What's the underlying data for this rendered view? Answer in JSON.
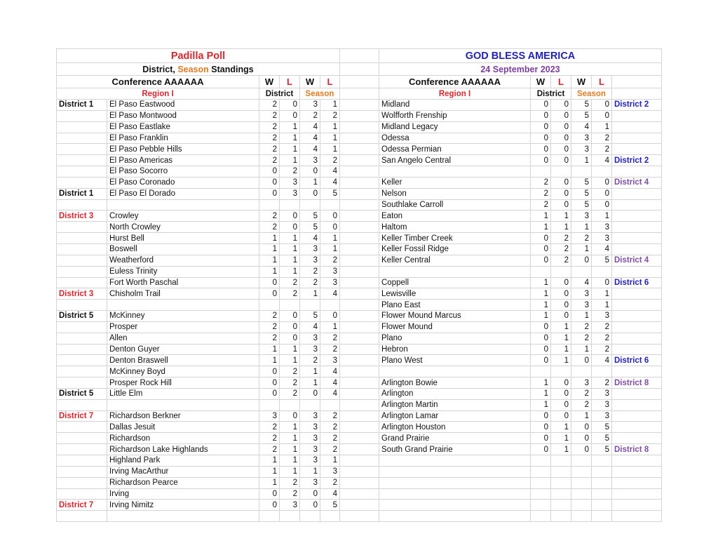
{
  "left": {
    "title": "Padilla Poll",
    "subtitle_parts": [
      "District, ",
      "Season",
      " Standings"
    ],
    "conference": "Conference AAAAAA",
    "region": "Region I",
    "col_w": "W",
    "col_l": "L",
    "group_district": "District",
    "group_season": "Season",
    "rows": [
      {
        "label": "District 1",
        "label_color": "black",
        "team": "El Paso Eastwood",
        "dw": "2",
        "dl": "0",
        "sw": "3",
        "sl": "1"
      },
      {
        "label": "",
        "label_color": "",
        "team": "El Paso Montwood",
        "dw": "2",
        "dl": "0",
        "sw": "2",
        "sl": "2"
      },
      {
        "label": "",
        "label_color": "",
        "team": "El Paso Eastlake",
        "dw": "2",
        "dl": "1",
        "sw": "4",
        "sl": "1"
      },
      {
        "label": "",
        "label_color": "",
        "team": "El Paso Franklin",
        "dw": "2",
        "dl": "1",
        "sw": "4",
        "sl": "1"
      },
      {
        "label": "",
        "label_color": "",
        "team": "El Paso Pebble Hills",
        "dw": "2",
        "dl": "1",
        "sw": "4",
        "sl": "1"
      },
      {
        "label": "",
        "label_color": "",
        "team": "El Paso Americas",
        "dw": "2",
        "dl": "1",
        "sw": "3",
        "sl": "2"
      },
      {
        "label": "",
        "label_color": "",
        "team": "El Paso Socorro",
        "dw": "0",
        "dl": "2",
        "sw": "0",
        "sl": "4"
      },
      {
        "label": "",
        "label_color": "",
        "team": "El Paso Coronado",
        "dw": "0",
        "dl": "3",
        "sw": "1",
        "sl": "4"
      },
      {
        "label": "District 1",
        "label_color": "black",
        "team": "El Paso El Dorado",
        "dw": "0",
        "dl": "3",
        "sw": "0",
        "sl": "5"
      },
      {
        "label": "",
        "label_color": "",
        "team": "",
        "dw": "",
        "dl": "",
        "sw": "",
        "sl": ""
      },
      {
        "label": "District 3",
        "label_color": "red",
        "team": "Crowley",
        "dw": "2",
        "dl": "0",
        "sw": "5",
        "sl": "0"
      },
      {
        "label": "",
        "label_color": "",
        "team": "North Crowley",
        "dw": "2",
        "dl": "0",
        "sw": "5",
        "sl": "0"
      },
      {
        "label": "",
        "label_color": "",
        "team": "Hurst Bell",
        "dw": "1",
        "dl": "1",
        "sw": "4",
        "sl": "1"
      },
      {
        "label": "",
        "label_color": "",
        "team": "Boswell",
        "dw": "1",
        "dl": "1",
        "sw": "3",
        "sl": "1"
      },
      {
        "label": "",
        "label_color": "",
        "team": "Weatherford",
        "dw": "1",
        "dl": "1",
        "sw": "3",
        "sl": "2"
      },
      {
        "label": "",
        "label_color": "",
        "team": "Euless Trinity",
        "dw": "1",
        "dl": "1",
        "sw": "2",
        "sl": "3"
      },
      {
        "label": "",
        "label_color": "",
        "team": "Fort Worth Paschal",
        "dw": "0",
        "dl": "2",
        "sw": "2",
        "sl": "3"
      },
      {
        "label": "District 3",
        "label_color": "red",
        "team": "Chisholm Trail",
        "dw": "0",
        "dl": "2",
        "sw": "1",
        "sl": "4"
      },
      {
        "label": "",
        "label_color": "",
        "team": "",
        "dw": "",
        "dl": "",
        "sw": "",
        "sl": ""
      },
      {
        "label": "District 5",
        "label_color": "black",
        "team": "McKinney",
        "dw": "2",
        "dl": "0",
        "sw": "5",
        "sl": "0"
      },
      {
        "label": "",
        "label_color": "",
        "team": "Prosper",
        "dw": "2",
        "dl": "0",
        "sw": "4",
        "sl": "1"
      },
      {
        "label": "",
        "label_color": "",
        "team": "Allen",
        "dw": "2",
        "dl": "0",
        "sw": "3",
        "sl": "2"
      },
      {
        "label": "",
        "label_color": "",
        "team": "Denton Guyer",
        "dw": "1",
        "dl": "1",
        "sw": "3",
        "sl": "2"
      },
      {
        "label": "",
        "label_color": "",
        "team": "Denton Braswell",
        "dw": "1",
        "dl": "1",
        "sw": "2",
        "sl": "3"
      },
      {
        "label": "",
        "label_color": "",
        "team": "McKinney Boyd",
        "dw": "0",
        "dl": "2",
        "sw": "1",
        "sl": "4"
      },
      {
        "label": "",
        "label_color": "",
        "team": "Prosper Rock Hill",
        "dw": "0",
        "dl": "2",
        "sw": "1",
        "sl": "4"
      },
      {
        "label": "District 5",
        "label_color": "black",
        "team": "Little Elm",
        "dw": "0",
        "dl": "2",
        "sw": "0",
        "sl": "4"
      },
      {
        "label": "",
        "label_color": "",
        "team": "",
        "dw": "",
        "dl": "",
        "sw": "",
        "sl": ""
      },
      {
        "label": "District 7",
        "label_color": "red",
        "team": "Richardson Berkner",
        "dw": "3",
        "dl": "0",
        "sw": "3",
        "sl": "2"
      },
      {
        "label": "",
        "label_color": "",
        "team": "Dallas Jesuit",
        "dw": "2",
        "dl": "1",
        "sw": "3",
        "sl": "2"
      },
      {
        "label": "",
        "label_color": "",
        "team": "Richardson",
        "dw": "2",
        "dl": "1",
        "sw": "3",
        "sl": "2"
      },
      {
        "label": "",
        "label_color": "",
        "team": "Richardson Lake Highlands",
        "dw": "2",
        "dl": "1",
        "sw": "3",
        "sl": "2"
      },
      {
        "label": "",
        "label_color": "",
        "team": "Highland Park",
        "dw": "1",
        "dl": "1",
        "sw": "3",
        "sl": "1"
      },
      {
        "label": "",
        "label_color": "",
        "team": "Irving MacArthur",
        "dw": "1",
        "dl": "1",
        "sw": "1",
        "sl": "3"
      },
      {
        "label": "",
        "label_color": "",
        "team": "Richardson Pearce",
        "dw": "1",
        "dl": "2",
        "sw": "3",
        "sl": "2"
      },
      {
        "label": "",
        "label_color": "",
        "team": "Irving",
        "dw": "0",
        "dl": "2",
        "sw": "0",
        "sl": "4"
      },
      {
        "label": "District 7",
        "label_color": "red",
        "team": "Irving Nimitz",
        "dw": "0",
        "dl": "3",
        "sw": "0",
        "sl": "5"
      },
      {
        "label": "",
        "label_color": "",
        "team": "",
        "dw": "",
        "dl": "",
        "sw": "",
        "sl": ""
      }
    ]
  },
  "right": {
    "title": "GOD BLESS AMERICA",
    "date": "24 September 2023",
    "conference": "Conference AAAAAA",
    "region": "Region I",
    "col_w": "W",
    "col_l": "L",
    "group_district": "District",
    "group_season": "Season",
    "rows": [
      {
        "team": "Midland",
        "dw": "0",
        "dl": "0",
        "sw": "5",
        "sl": "0",
        "label": "District 2",
        "label_color": "blue"
      },
      {
        "team": "Wolfforth Frenship",
        "dw": "0",
        "dl": "0",
        "sw": "5",
        "sl": "0",
        "label": "",
        "label_color": ""
      },
      {
        "team": "Midland Legacy",
        "dw": "0",
        "dl": "0",
        "sw": "4",
        "sl": "1",
        "label": "",
        "label_color": ""
      },
      {
        "team": "Odessa",
        "dw": "0",
        "dl": "0",
        "sw": "3",
        "sl": "2",
        "label": "",
        "label_color": ""
      },
      {
        "team": "Odessa Permian",
        "dw": "0",
        "dl": "0",
        "sw": "3",
        "sl": "2",
        "label": "",
        "label_color": ""
      },
      {
        "team": "San Angelo Central",
        "dw": "0",
        "dl": "0",
        "sw": "1",
        "sl": "4",
        "label": "District 2",
        "label_color": "blue"
      },
      {
        "team": "",
        "dw": "",
        "dl": "",
        "sw": "",
        "sl": "",
        "label": "",
        "label_color": ""
      },
      {
        "team": "Keller",
        "dw": "2",
        "dl": "0",
        "sw": "5",
        "sl": "0",
        "label": "District 4",
        "label_color": "purple"
      },
      {
        "team": "Nelson",
        "dw": "2",
        "dl": "0",
        "sw": "5",
        "sl": "0",
        "label": "",
        "label_color": ""
      },
      {
        "team": "Southlake Carroll",
        "dw": "2",
        "dl": "0",
        "sw": "5",
        "sl": "0",
        "label": "",
        "label_color": ""
      },
      {
        "team": "Eaton",
        "dw": "1",
        "dl": "1",
        "sw": "3",
        "sl": "1",
        "label": "",
        "label_color": ""
      },
      {
        "team": "Haltom",
        "dw": "1",
        "dl": "1",
        "sw": "1",
        "sl": "3",
        "label": "",
        "label_color": ""
      },
      {
        "team": "Keller Timber Creek",
        "dw": "0",
        "dl": "2",
        "sw": "2",
        "sl": "3",
        "label": "",
        "label_color": ""
      },
      {
        "team": "Keller Fossil Ridge",
        "dw": "0",
        "dl": "2",
        "sw": "1",
        "sl": "4",
        "label": "",
        "label_color": ""
      },
      {
        "team": "Keller Central",
        "dw": "0",
        "dl": "2",
        "sw": "0",
        "sl": "5",
        "label": "District 4",
        "label_color": "purple"
      },
      {
        "team": "",
        "dw": "",
        "dl": "",
        "sw": "",
        "sl": "",
        "label": "",
        "label_color": ""
      },
      {
        "team": "Coppell",
        "dw": "1",
        "dl": "0",
        "sw": "4",
        "sl": "0",
        "label": "District 6",
        "label_color": "blue"
      },
      {
        "team": "Lewisville",
        "dw": "1",
        "dl": "0",
        "sw": "3",
        "sl": "1",
        "label": "",
        "label_color": ""
      },
      {
        "team": "Plano East",
        "dw": "1",
        "dl": "0",
        "sw": "3",
        "sl": "1",
        "label": "",
        "label_color": ""
      },
      {
        "team": "Flower Mound Marcus",
        "dw": "1",
        "dl": "0",
        "sw": "1",
        "sl": "3",
        "label": "",
        "label_color": ""
      },
      {
        "team": "Flower Mound",
        "dw": "0",
        "dl": "1",
        "sw": "2",
        "sl": "2",
        "label": "",
        "label_color": ""
      },
      {
        "team": "Plano",
        "dw": "0",
        "dl": "1",
        "sw": "2",
        "sl": "2",
        "label": "",
        "label_color": ""
      },
      {
        "team": "Hebron",
        "dw": "0",
        "dl": "1",
        "sw": "1",
        "sl": "2",
        "label": "",
        "label_color": ""
      },
      {
        "team": "Plano West",
        "dw": "0",
        "dl": "1",
        "sw": "0",
        "sl": "4",
        "label": "District 6",
        "label_color": "blue"
      },
      {
        "team": "",
        "dw": "",
        "dl": "",
        "sw": "",
        "sl": "",
        "label": "",
        "label_color": ""
      },
      {
        "team": "Arlington Bowie",
        "dw": "1",
        "dl": "0",
        "sw": "3",
        "sl": "2",
        "label": "District 8",
        "label_color": "purple"
      },
      {
        "team": "Arlington",
        "dw": "1",
        "dl": "0",
        "sw": "2",
        "sl": "3",
        "label": "",
        "label_color": ""
      },
      {
        "team": "Arlington Martin",
        "dw": "1",
        "dl": "0",
        "sw": "2",
        "sl": "3",
        "label": "",
        "label_color": ""
      },
      {
        "team": "Arlington Lamar",
        "dw": "0",
        "dl": "0",
        "sw": "1",
        "sl": "3",
        "label": "",
        "label_color": ""
      },
      {
        "team": "Arlington Houston",
        "dw": "0",
        "dl": "1",
        "sw": "0",
        "sl": "5",
        "label": "",
        "label_color": ""
      },
      {
        "team": "Grand Prairie",
        "dw": "0",
        "dl": "1",
        "sw": "0",
        "sl": "5",
        "label": "",
        "label_color": ""
      },
      {
        "team": "South Grand Prairie",
        "dw": "0",
        "dl": "1",
        "sw": "0",
        "sl": "5",
        "label": "District 8",
        "label_color": "purple"
      },
      {
        "team": "",
        "dw": "",
        "dl": "",
        "sw": "",
        "sl": "",
        "label": "",
        "label_color": ""
      },
      {
        "team": "",
        "dw": "",
        "dl": "",
        "sw": "",
        "sl": "",
        "label": "",
        "label_color": ""
      },
      {
        "team": "",
        "dw": "",
        "dl": "",
        "sw": "",
        "sl": "",
        "label": "",
        "label_color": ""
      },
      {
        "team": "",
        "dw": "",
        "dl": "",
        "sw": "",
        "sl": "",
        "label": "",
        "label_color": ""
      },
      {
        "team": "",
        "dw": "",
        "dl": "",
        "sw": "",
        "sl": "",
        "label": "",
        "label_color": ""
      },
      {
        "team": "",
        "dw": "",
        "dl": "",
        "sw": "",
        "sl": "",
        "label": "",
        "label_color": ""
      }
    ]
  },
  "colors": {
    "red": "#d7262e",
    "orange": "#e07b24",
    "blue": "#2222bb",
    "purple": "#7e4ea3",
    "date_purple": "#7a3f9d",
    "grid": "#d4d4d4"
  }
}
